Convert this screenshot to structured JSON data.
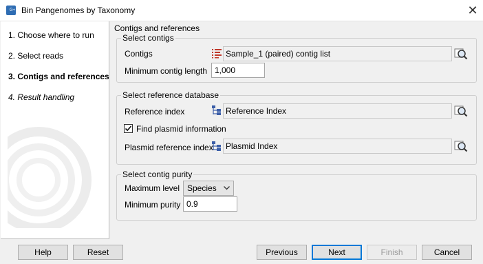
{
  "window": {
    "title": "Bin Pangenomes by Taxonomy",
    "app_icon_text": "G+"
  },
  "steps": [
    {
      "label": "1.  Choose where to run"
    },
    {
      "label": "2.  Select reads"
    },
    {
      "label": "3.  Contigs and references"
    },
    {
      "label": "4.  Result handling"
    }
  ],
  "page": {
    "header": "Contigs and references"
  },
  "select_contigs": {
    "title": "Select contigs",
    "contigs_label": "Contigs",
    "contigs_value": "Sample_1 (paired) contig list",
    "min_length_label": "Minimum contig length",
    "min_length_value": "1,000"
  },
  "reference_db": {
    "title": "Select reference database",
    "reference_index_label": "Reference index",
    "reference_index_value": "Reference Index",
    "find_plasmid_label": "Find plasmid information",
    "find_plasmid_checked": true,
    "plasmid_ref_label": "Plasmid reference index",
    "plasmid_ref_value": "Plasmid Index"
  },
  "purity": {
    "title": "Select contig purity",
    "max_level_label": "Maximum level",
    "max_level_value": "Species",
    "min_purity_label": "Minimum purity",
    "min_purity_value": "0.9"
  },
  "buttons": {
    "help": "Help",
    "reset": "Reset",
    "previous": "Previous",
    "next": "Next",
    "finish": "Finish",
    "cancel": "Cancel"
  },
  "colors": {
    "accent": "#0078d7",
    "list_icon": "#c0392b",
    "tree_icon": "#3b5ea8"
  }
}
